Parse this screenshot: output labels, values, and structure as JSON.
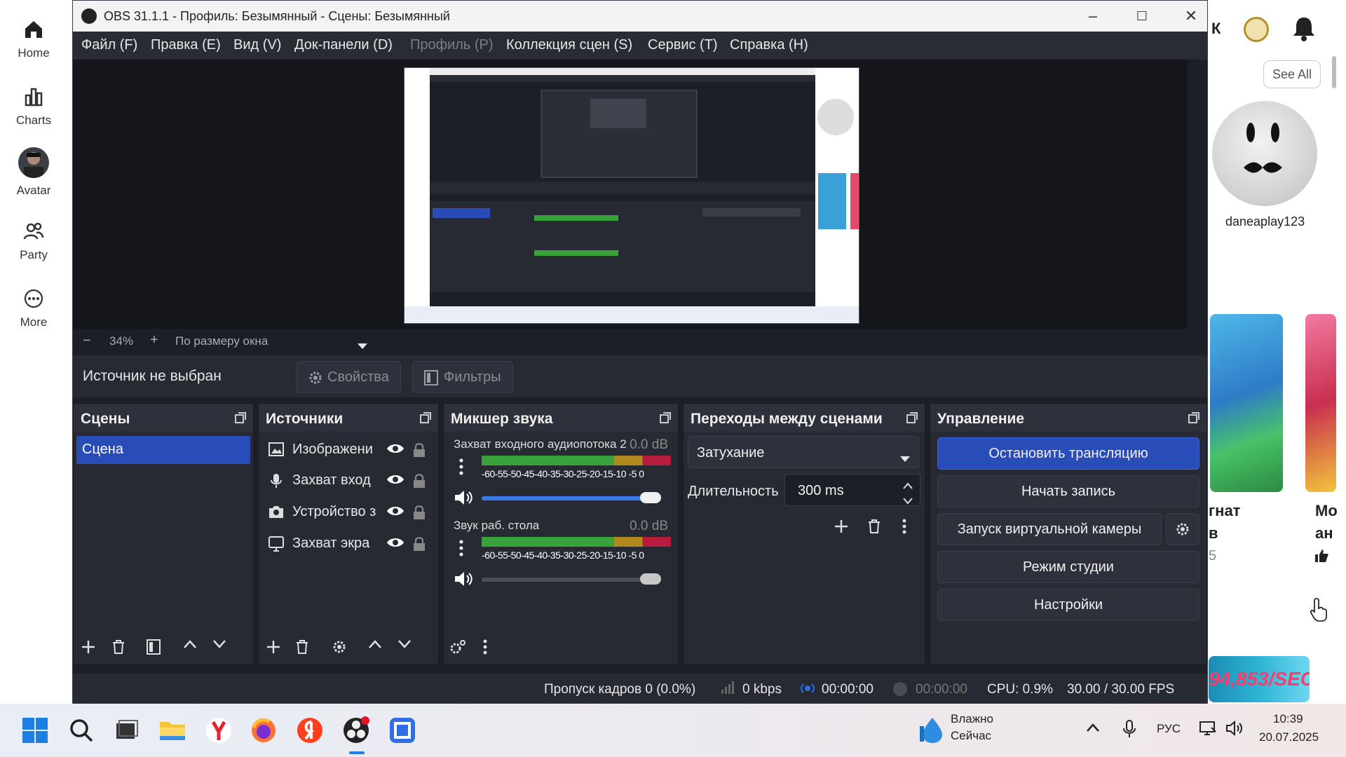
{
  "roblox": {
    "nav": [
      {
        "label": "Home",
        "icon": "home-icon"
      },
      {
        "label": "Charts",
        "icon": "charts-icon"
      },
      {
        "label": "Avatar",
        "icon": "avatar-icon"
      },
      {
        "label": "Party",
        "icon": "party-icon"
      },
      {
        "label": "More",
        "icon": "more-icon"
      }
    ],
    "see_all": "See All",
    "friend_name": "daneaplay123",
    "header_letter": "К",
    "card_text_1": "гнат",
    "card_text_1b": "в",
    "card_text_1c": "5",
    "card_text_2": "Мо",
    "card_text_2b": "ан",
    "ad_text": "94,853/SEC"
  },
  "obs": {
    "title": "OBS 31.1.1 - Профиль: Безымянный - Сцены: Безымянный",
    "menu": [
      "Файл (F)",
      "Правка (E)",
      "Вид (V)",
      "Док-панели (D)",
      "Профиль (P)",
      "Коллекция сцен (S)",
      "Сервис (T)",
      "Справка (H)"
    ],
    "zoom": {
      "minus": "−",
      "value": "34%",
      "plus": "+",
      "mode": "По размеру окна"
    },
    "source_bar": {
      "label": "Источник не выбран",
      "properties": "Свойства",
      "filters": "Фильтры"
    },
    "docks": {
      "scenes": {
        "title": "Сцены",
        "items": [
          "Сцена"
        ]
      },
      "sources": {
        "title": "Источники",
        "items": [
          {
            "name": "Изображени",
            "icon": "image-icon"
          },
          {
            "name": "Захват вход",
            "icon": "microphone-icon"
          },
          {
            "name": "Устройство з",
            "icon": "camera-icon"
          },
          {
            "name": "Захват экра",
            "icon": "monitor-icon"
          }
        ]
      },
      "mixer": {
        "title": "Микшер звука",
        "channels": [
          {
            "name": "Захват входного аудиопотока 2",
            "db": "0.0 dB",
            "scale": "-60-55-50-45-40-35-30-25-20-15-10 -5 0",
            "volume": 1.0,
            "active": true
          },
          {
            "name": "Звук раб. стола",
            "db": "0.0 dB",
            "scale": "-60-55-50-45-40-35-30-25-20-15-10 -5 0",
            "volume": 1.0,
            "active": false
          }
        ]
      },
      "transitions": {
        "title": "Переходы между сценами",
        "selected": "Затухание",
        "duration_label": "Длительность",
        "duration_value": "300 ms"
      },
      "controls": {
        "title": "Управление",
        "stop_stream": "Остановить трансляцию",
        "start_record": "Начать запись",
        "virtual_cam": "Запуск виртуальной камеры",
        "studio_mode": "Режим студии",
        "settings": "Настройки"
      }
    },
    "status": {
      "dropped": "Пропуск кадров 0 (0.0%)",
      "bitrate": "0 kbps",
      "stream_time": "00:00:00",
      "record_time": "00:00:00",
      "cpu": "CPU: 0.9%",
      "fps": "30.00 / 30.00 FPS"
    }
  },
  "taskbar": {
    "weather_line1": "Влажно",
    "weather_line2": "Сейчас",
    "lang": "РУС",
    "time": "10:39",
    "date": "20.07.2025"
  }
}
